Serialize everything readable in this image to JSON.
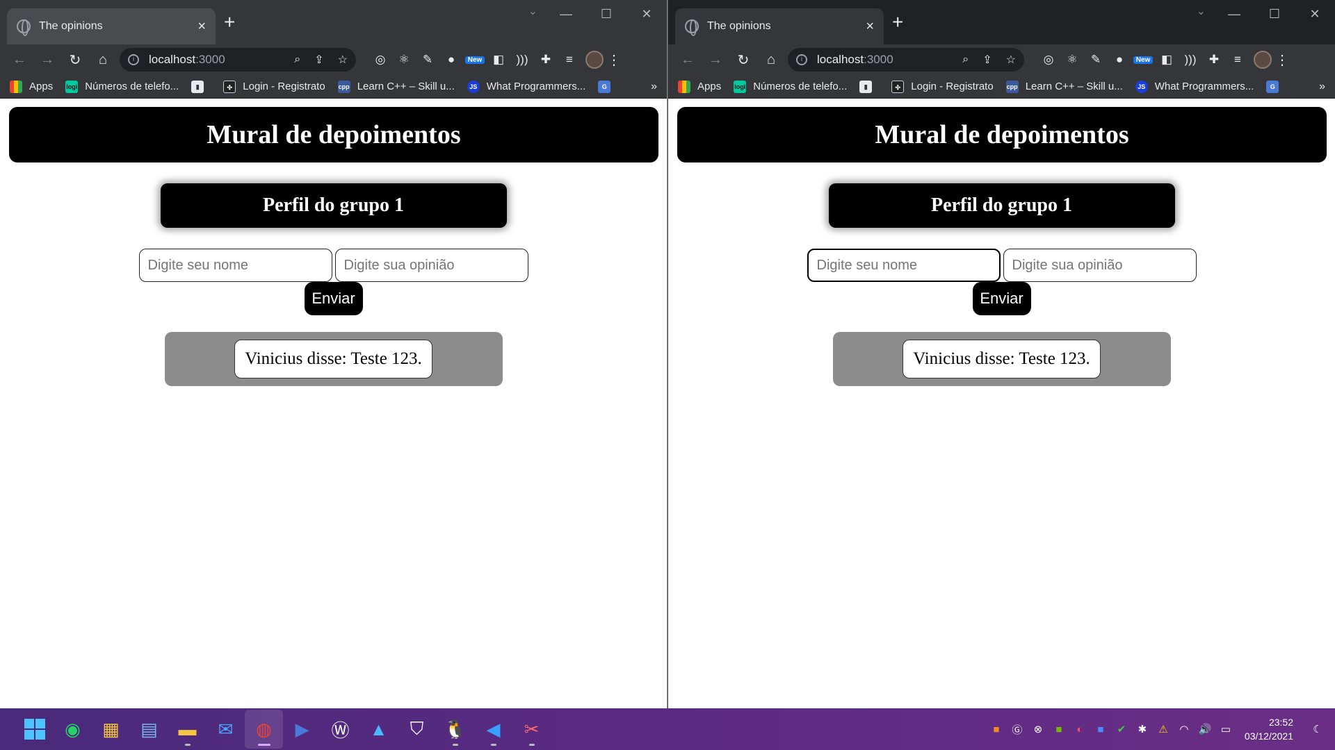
{
  "browser": {
    "tab_title": "The opinions",
    "url_host": "localhost",
    "url_port": ":3000",
    "bookmarks": [
      {
        "label": "Apps",
        "icon": "apps"
      },
      {
        "label": "Números de telefo...",
        "icon": "logi"
      },
      {
        "label": "",
        "icon": "purple"
      },
      {
        "label": "Login - Registrato",
        "icon": "login"
      },
      {
        "label": "Learn C++ – Skill u...",
        "icon": "cpp"
      },
      {
        "label": "What Programmers...",
        "icon": "js"
      },
      {
        "label": "",
        "icon": "gt"
      }
    ],
    "new_badge": "New",
    "more_bookmarks": "»"
  },
  "page": {
    "header": "Mural de depoimentos",
    "profile_title": "Perfil do grupo 1",
    "name_placeholder": "Digite seu nome",
    "opinion_placeholder": "Digite sua opinião",
    "send_label": "Enviar",
    "opinions": [
      "Vinicius disse: Teste 123."
    ]
  },
  "taskbar": {
    "time": "23:52",
    "date": "03/12/2021"
  }
}
